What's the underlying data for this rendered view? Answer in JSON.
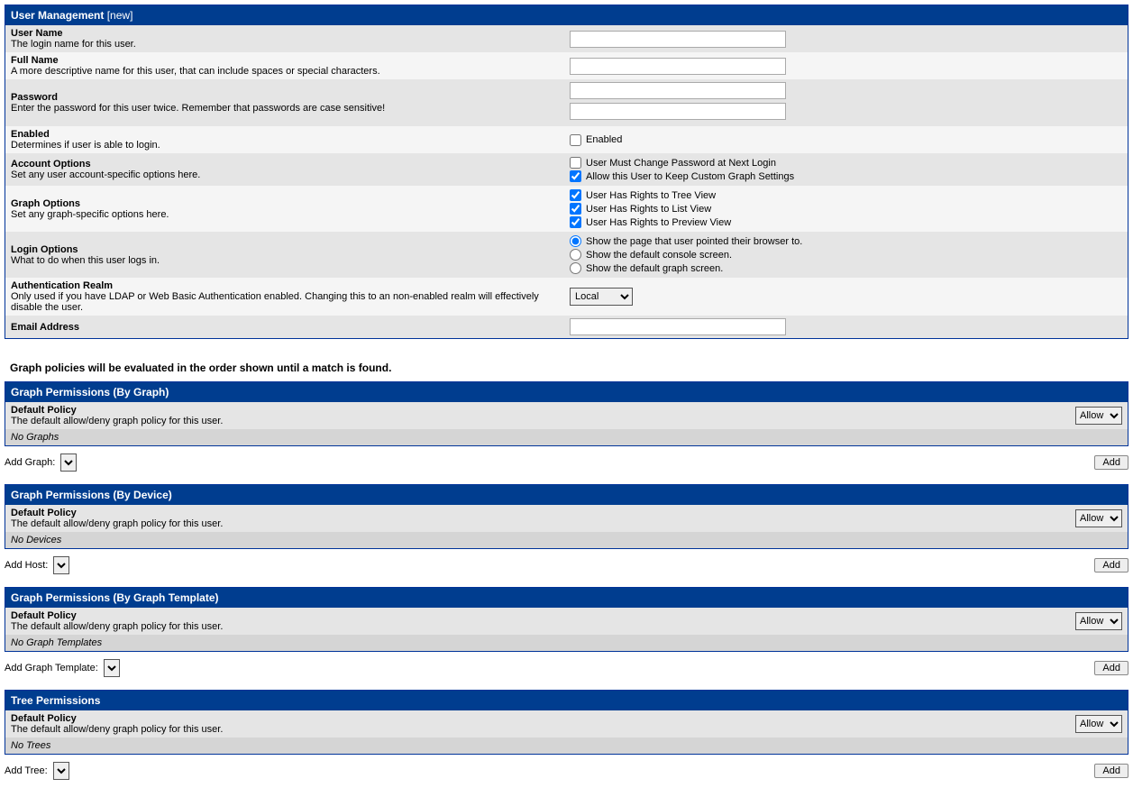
{
  "mainHeader": {
    "title": "User Management",
    "suffix": "[new]"
  },
  "fields": {
    "username": {
      "title": "User Name",
      "desc": "The login name for this user."
    },
    "fullname": {
      "title": "Full Name",
      "desc": "A more descriptive name for this user, that can include spaces or special characters."
    },
    "password": {
      "title": "Password",
      "desc": "Enter the password for this user twice. Remember that passwords are case sensitive!"
    },
    "enabled": {
      "title": "Enabled",
      "desc": "Determines if user is able to login.",
      "cb": "Enabled"
    },
    "account": {
      "title": "Account Options",
      "desc": "Set any user account-specific options here.",
      "opts": [
        "User Must Change Password at Next Login",
        "Allow this User to Keep Custom Graph Settings"
      ]
    },
    "graph": {
      "title": "Graph Options",
      "desc": "Set any graph-specific options here.",
      "opts": [
        "User Has Rights to Tree View",
        "User Has Rights to List View",
        "User Has Rights to Preview View"
      ]
    },
    "login": {
      "title": "Login Options",
      "desc": "What to do when this user logs in.",
      "opts": [
        "Show the page that user pointed their browser to.",
        "Show the default console screen.",
        "Show the default graph screen."
      ]
    },
    "auth": {
      "title": "Authentication Realm",
      "desc": "Only used if you have LDAP or Web Basic Authentication enabled. Changing this to an non-enabled realm will effectively disable the user.",
      "value": "Local"
    },
    "email": {
      "title": "Email Address"
    }
  },
  "note": "Graph policies will be evaluated in the order shown until a match is found.",
  "defaultPolicy": {
    "title": "Default Policy",
    "desc": "The default allow/deny graph policy for this user.",
    "value": "Allow"
  },
  "perm1": {
    "header": "Graph Permissions (By Graph)",
    "empty": "No Graphs",
    "addLabel": "Add Graph:"
  },
  "perm2": {
    "header": "Graph Permissions (By Device)",
    "empty": "No Devices",
    "addLabel": "Add Host:"
  },
  "perm3": {
    "header": "Graph Permissions (By Graph Template)",
    "empty": "No Graph Templates",
    "addLabel": "Add Graph Template:"
  },
  "perm4": {
    "header": "Tree Permissions",
    "empty": "No Trees",
    "addLabel": "Add Tree:"
  },
  "addButton": "Add"
}
